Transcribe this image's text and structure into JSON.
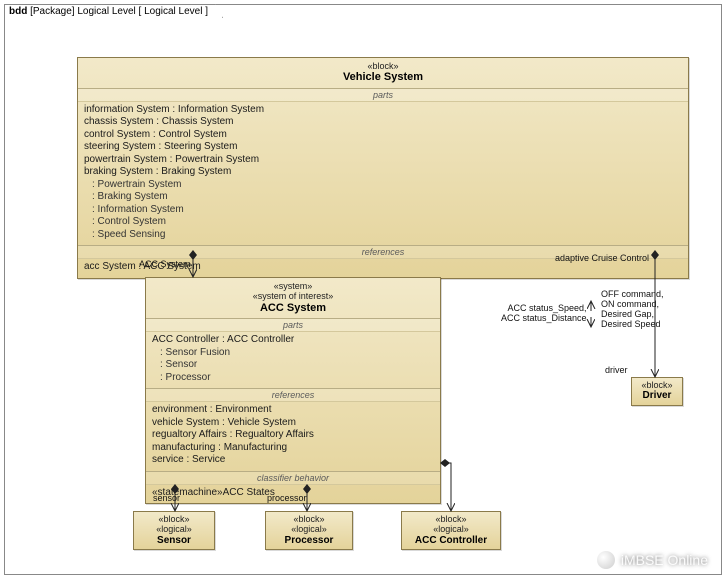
{
  "tab": {
    "prefix": "bdd",
    "middle": "[Package] Logical Level",
    "suffix": "[ Logical Level ]"
  },
  "vehicle": {
    "stereo": "«block»",
    "name": "Vehicle System",
    "parts_label": "parts",
    "parts": [
      "information System : Information System",
      "chassis System : Chassis System",
      "control System : Control System",
      "steering System : Steering System",
      "powertrain System : Powertrain System",
      "braking System : Braking System"
    ],
    "parts_unnamed": [
      ": Powertrain System",
      ": Braking System",
      ": Information System",
      ": Control System",
      ": Speed Sensing"
    ],
    "refs_label": "references",
    "refs": [
      "acc System : ACC System"
    ]
  },
  "acc": {
    "stereo1": "«system»",
    "stereo2": "«system of interest»",
    "name": "ACC System",
    "parts_label": "parts",
    "parts_head": "ACC Controller : ACC Controller",
    "parts_sub": [
      ": Sensor Fusion",
      ": Sensor",
      ": Processor"
    ],
    "refs_label": "references",
    "refs": [
      "environment : Environment",
      "vehicle System : Vehicle System",
      "regualtory Affairs : Regualtory Affairs",
      "manufacturing : Manufacturing",
      "service : Service"
    ],
    "cb_label": "classifier behavior",
    "cb": "«statemachine»ACC States"
  },
  "driver": {
    "stereo": "«block»",
    "name": "Driver"
  },
  "sensor": {
    "s1": "«block»",
    "s2": "«logical»",
    "name": "Sensor"
  },
  "processor": {
    "s1": "«block»",
    "s2": "«logical»",
    "name": "Processor"
  },
  "acc_ctrl": {
    "s1": "«block»",
    "s2": "«logical»",
    "name": "ACC Controller"
  },
  "edge": {
    "acc_system_role": "ACC System",
    "adaptive": "adaptive Cruise Control",
    "driver_role": "driver",
    "flow_left1": "ACC status_Speed,",
    "flow_left2": "ACC status_Distance",
    "flow_right1": "OFF command,",
    "flow_right2": "ON command,",
    "flow_right3": "Desired Gap,",
    "flow_right4": "Desired Speed",
    "sensor_role": "sensor",
    "processor_role": "processor"
  },
  "watermark": "iMBSE Online"
}
